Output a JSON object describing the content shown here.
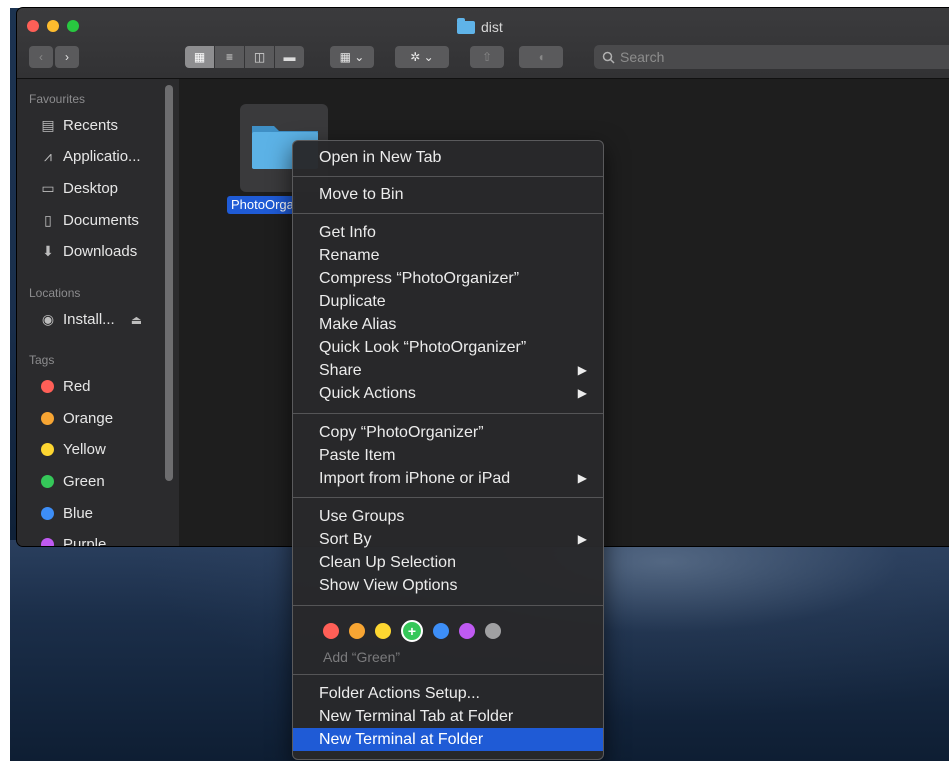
{
  "window": {
    "title": "dist"
  },
  "toolbar": {
    "back_glyph": "‹",
    "forward_glyph": "›",
    "view_buttons": [
      "▦",
      "≡",
      "◫",
      "▬"
    ],
    "group_glyph": "▦ ⌄",
    "action_glyph": "✲ ⌄",
    "share_glyph": "⇧",
    "tag_glyph": "◖",
    "search_placeholder": "Search"
  },
  "sidebar": {
    "favourites_header": "Favourites",
    "favourites": [
      {
        "label": "Recents",
        "icon": "recents-icon",
        "glyph": "▤"
      },
      {
        "label": "Applicatio...",
        "icon": "applications-icon",
        "glyph": "⩘"
      },
      {
        "label": "Desktop",
        "icon": "desktop-icon",
        "glyph": "▭"
      },
      {
        "label": "Documents",
        "icon": "documents-icon",
        "glyph": "▯"
      },
      {
        "label": "Downloads",
        "icon": "downloads-icon",
        "glyph": "⬇"
      }
    ],
    "locations_header": "Locations",
    "locations": [
      {
        "label": "Install...",
        "icon": "disk-icon",
        "glyph": "◉",
        "eject": "⏏"
      }
    ],
    "tags_header": "Tags",
    "tags": [
      {
        "label": "Red",
        "color": "#ff5f57"
      },
      {
        "label": "Orange",
        "color": "#f7a533"
      },
      {
        "label": "Yellow",
        "color": "#fdd631"
      },
      {
        "label": "Green",
        "color": "#35c759"
      },
      {
        "label": "Blue",
        "color": "#3d8ef7"
      },
      {
        "label": "Purple",
        "color": "#bf5af2"
      }
    ]
  },
  "content": {
    "folder_name": "PhotoOrganizer"
  },
  "context_menu": {
    "groups": [
      [
        {
          "label": "Open in New Tab"
        }
      ],
      [
        {
          "label": "Move to Bin"
        }
      ],
      [
        {
          "label": "Get Info"
        },
        {
          "label": "Rename"
        },
        {
          "label": "Compress “PhotoOrganizer”"
        },
        {
          "label": "Duplicate"
        },
        {
          "label": "Make Alias"
        },
        {
          "label": "Quick Look “PhotoOrganizer”"
        },
        {
          "label": "Share",
          "submenu": true
        },
        {
          "label": "Quick Actions",
          "submenu": true
        }
      ],
      [
        {
          "label": "Copy “PhotoOrganizer”"
        },
        {
          "label": "Paste Item"
        },
        {
          "label": "Import from iPhone or iPad",
          "submenu": true
        }
      ],
      [
        {
          "label": "Use Groups"
        },
        {
          "label": "Sort By",
          "submenu": true
        },
        {
          "label": "Clean Up Selection"
        },
        {
          "label": "Show View Options"
        }
      ]
    ],
    "tag_colors": [
      "#ff5f57",
      "#f7a533",
      "#fdd631",
      "#35c759",
      "#3d8ef7",
      "#bf5af2",
      "#a0a0a2"
    ],
    "current_tag_glyph": "+",
    "add_tag_label": "Add “Green”",
    "bottom_items": [
      {
        "label": "Folder Actions Setup..."
      },
      {
        "label": "New Terminal Tab at Folder"
      },
      {
        "label": "New Terminal at Folder",
        "highlighted": true
      }
    ],
    "submenu_glyph": "▶"
  }
}
